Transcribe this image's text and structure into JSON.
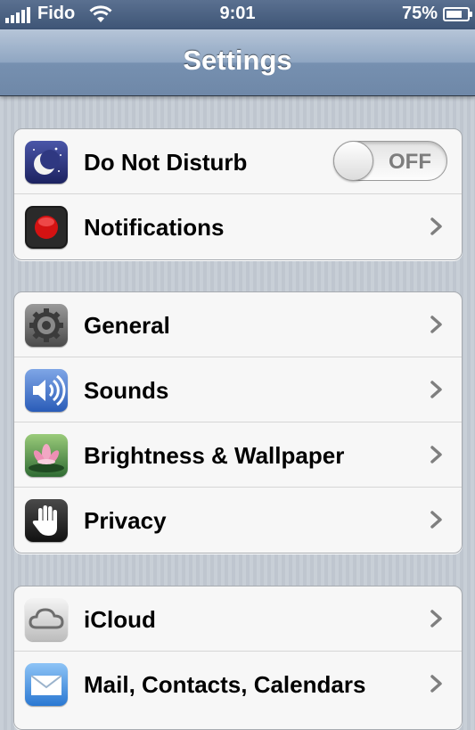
{
  "status_bar": {
    "carrier": "Fido",
    "time": "9:01",
    "battery_percent": "75%",
    "battery_level": 0.75,
    "signal_bars": 5
  },
  "nav": {
    "title": "Settings"
  },
  "groups": [
    {
      "items": [
        {
          "label": "Do Not Disturb",
          "icon": "moon-icon",
          "accessory": "toggle",
          "toggle_state": "OFF"
        },
        {
          "label": "Notifications",
          "icon": "notifications-icon",
          "accessory": "chevron"
        }
      ]
    },
    {
      "items": [
        {
          "label": "General",
          "icon": "gear-icon",
          "accessory": "chevron"
        },
        {
          "label": "Sounds",
          "icon": "speaker-icon",
          "accessory": "chevron"
        },
        {
          "label": "Brightness & Wallpaper",
          "icon": "flower-icon",
          "accessory": "chevron"
        },
        {
          "label": "Privacy",
          "icon": "hand-icon",
          "accessory": "chevron"
        }
      ]
    },
    {
      "items": [
        {
          "label": "iCloud",
          "icon": "cloud-icon",
          "accessory": "chevron"
        },
        {
          "label": "Mail, Contacts, Calendars",
          "icon": "mail-icon",
          "accessory": "chevron"
        }
      ]
    }
  ],
  "colors": {
    "nav_gradient_top": "#b6c5d8",
    "nav_gradient_bottom": "#6f88a8",
    "background": "#c5ccd4",
    "cell_background": "#f7f7f7"
  }
}
